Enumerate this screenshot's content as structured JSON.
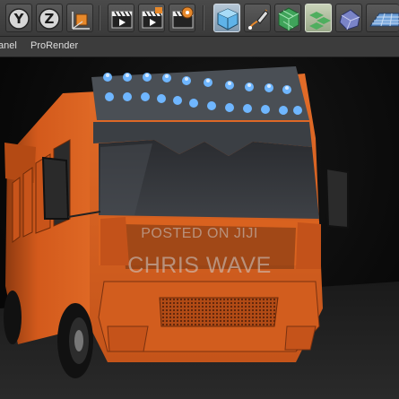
{
  "toolbar": {
    "icons": [
      {
        "name": "y-axis-lock-icon",
        "glyph": "Y"
      },
      {
        "name": "z-axis-lock-icon",
        "glyph": "Z"
      },
      {
        "name": "coordinate-system-icon"
      },
      {
        "name": "render-view-icon"
      },
      {
        "name": "render-to-picture-viewer-icon"
      },
      {
        "name": "render-settings-icon"
      },
      {
        "name": "cube-primitive-icon"
      },
      {
        "name": "pen-spline-icon"
      },
      {
        "name": "subdivision-surface-icon"
      },
      {
        "name": "cloner-icon"
      },
      {
        "name": "deformer-icon"
      },
      {
        "name": "floor-icon"
      }
    ],
    "colors": {
      "accent_orange": "#e8892b",
      "active_blue": "#7f98ad"
    }
  },
  "menubar": {
    "items": [
      "anel",
      "ProRender"
    ]
  },
  "viewport": {
    "watermark_top": "POSTED ON JIJI",
    "watermark_main": "CHRIS WAVE",
    "body_color": "#d9601e"
  }
}
